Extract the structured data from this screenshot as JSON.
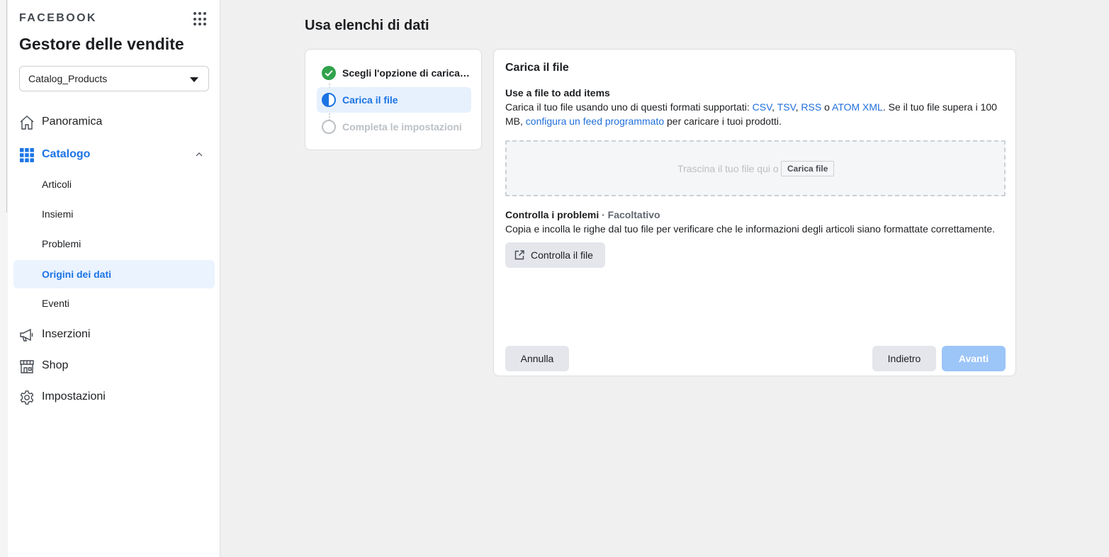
{
  "sidebar": {
    "brand": "FACEBOOK",
    "app_title": "Gestore delle vendite",
    "catalog_select": {
      "value": "Catalog_Products"
    },
    "nav": [
      {
        "label": "Panoramica",
        "icon": "home-icon"
      },
      {
        "label": "Catalogo",
        "icon": "catalog-grid-icon",
        "active": true,
        "expanded": true
      },
      {
        "label": "Inserzioni",
        "icon": "megaphone-icon"
      },
      {
        "label": "Shop",
        "icon": "shop-icon"
      },
      {
        "label": "Impostazioni",
        "icon": "gear-icon"
      }
    ],
    "catalog_subitems": [
      {
        "label": "Articoli"
      },
      {
        "label": "Insiemi"
      },
      {
        "label": "Problemi"
      },
      {
        "label": "Origini dei dati",
        "selected": true
      },
      {
        "label": "Eventi"
      }
    ]
  },
  "main": {
    "page_title": "Usa elenchi di dati",
    "steps": [
      {
        "label": "Scegli l'opzione di carica…",
        "status": "done"
      },
      {
        "label": "Carica il file",
        "status": "current"
      },
      {
        "label": "Completa le impostazioni",
        "status": "pending"
      }
    ],
    "card": {
      "title": "Carica il file",
      "upload_heading": "Use a file to add items",
      "upload_text_1": "Carica il tuo file usando uno di questi formati supportati: ",
      "format_csv": "CSV",
      "sep_1": ", ",
      "format_tsv": "TSV",
      "sep_2": ", ",
      "format_rss": "RSS",
      "sep_3": " o ",
      "format_atom": "ATOM XML",
      "upload_text_2": ". Se il tuo file supera i 100 MB, ",
      "scheduled_feed_link": "configura un feed programmato",
      "upload_text_3": " per caricare i tuoi prodotti.",
      "dropzone_text": "Trascina il tuo file qui o",
      "dropzone_button": "Carica file",
      "check_heading": "Controlla i problemi",
      "check_optional": "· Facoltativo",
      "check_text": "Copia e incolla le righe dal tuo file per verificare che le informazioni degli articoli siano formattate correttamente.",
      "check_button": "Controlla il file",
      "cancel_button": "Annulla",
      "back_button": "Indietro",
      "next_button": "Avanti"
    }
  },
  "colors": {
    "accent": "#1b74e4",
    "link": "#216fdb",
    "success": "#31a24c",
    "disabled_primary": "#9cc5f8",
    "selected_bg": "#ebf3ff"
  }
}
